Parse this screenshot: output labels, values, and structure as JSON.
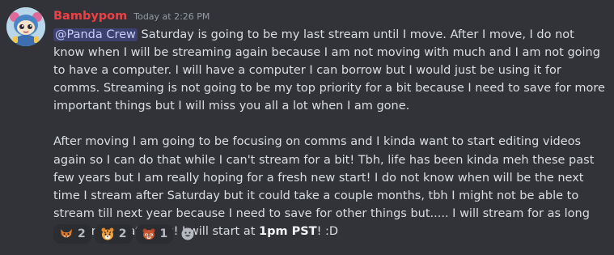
{
  "message": {
    "author": "Bambypom",
    "author_color": "#f23f43",
    "timestamp": "Today at 2:26 PM",
    "mention": "@Panda Crew",
    "paragraph1": " Saturday is going to be my last stream until I move. After I move, I do not know when I will be streaming again because I am not moving with much and I am not going to have a computer. I will have a computer I can borrow but I would just be using it for comms. Streaming is not going to be my top priority for a bit because I need to save for more important things but I will miss you all a lot when I am gone.",
    "paragraph2_before": "After moving I am going to be focusing on comms and I kinda want to start editing videos again so I can do that while I can't stream for a bit! Tbh, life has been kinda meh these past few years but I am really hoping for a fresh new start! I do not know when will be the next time I stream after Saturday but it could take a couple months, tbh I might not be able to stream till next year because I need to save for other things but..... I will stream for as long as I can on Saturday! I will start at ",
    "paragraph2_bold": "1pm PST",
    "paragraph2_after": "! :D"
  },
  "reactions": [
    {
      "icon": "fox-emoji-icon",
      "count": "2"
    },
    {
      "icon": "tiger-emoji-icon",
      "count": "2"
    },
    {
      "icon": "red-panda-emoji-icon",
      "count": "1"
    }
  ],
  "add_reaction_icon": "add-reaction-smiley-icon"
}
